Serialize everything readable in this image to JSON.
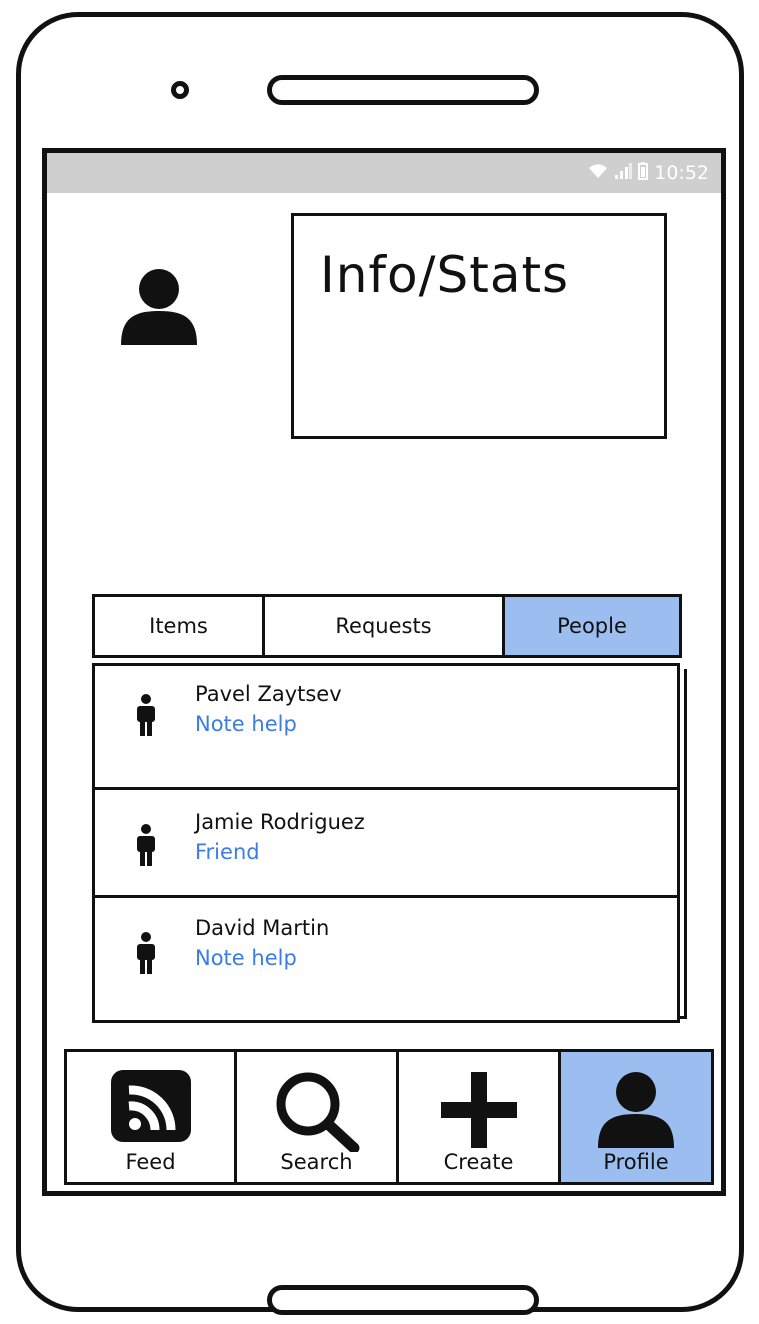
{
  "status_bar": {
    "time": "10:52",
    "icons": [
      "wifi-icon",
      "signal-icon",
      "battery-icon"
    ]
  },
  "header": {
    "info_title": "Info/Stats"
  },
  "tabs": [
    {
      "label": "Items",
      "active": false
    },
    {
      "label": "Requests",
      "active": false
    },
    {
      "label": "People",
      "active": true
    }
  ],
  "people": [
    {
      "name": "Pavel Zaytsev",
      "note": "Note help"
    },
    {
      "name": "Jamie Rodriguez",
      "note": "Friend"
    },
    {
      "name": "David Martin",
      "note": "Note help"
    }
  ],
  "bottom_nav": [
    {
      "label": "Feed",
      "icon": "rss-feed-icon",
      "active": false
    },
    {
      "label": "Search",
      "icon": "search-icon",
      "active": false
    },
    {
      "label": "Create",
      "icon": "plus-icon",
      "active": false
    },
    {
      "label": "Profile",
      "icon": "user-icon",
      "active": true
    }
  ],
  "colors": {
    "accent": "#9bbdf0",
    "link": "#3d7be6",
    "status_bar": "#cfcfcf"
  }
}
